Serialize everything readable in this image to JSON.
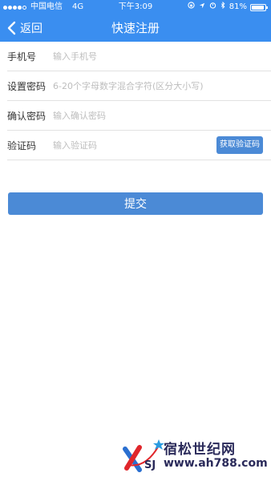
{
  "status_bar": {
    "carrier": "中国电信",
    "network": "4G",
    "time": "下午3:09",
    "battery": "81%",
    "battery_level": 0.81,
    "icons": [
      "lock-rotation-icon",
      "location-icon",
      "alarm-icon",
      "bluetooth-icon",
      "battery-icon"
    ]
  },
  "nav": {
    "back_label": "返回",
    "title": "快速注册",
    "back_icon": "chevron-left-icon"
  },
  "form": {
    "phone": {
      "label": "手机号",
      "placeholder": "输入手机号",
      "value": ""
    },
    "password": {
      "label": "设置密码",
      "placeholder": "6-20个字母数字混合字符(区分大小写)",
      "value": ""
    },
    "confirm": {
      "label": "确认密码",
      "placeholder": "输入确认密码",
      "value": ""
    },
    "code": {
      "label": "验证码",
      "placeholder": "输入验证码",
      "value": "",
      "button_label": "获取验证码"
    }
  },
  "submit_label": "提交",
  "watermark": {
    "name": "宿松世纪网",
    "url": "www.ah788.com",
    "logo_text": "SJ"
  },
  "colors": {
    "header": "#3a8ef0",
    "button": "#4b8ad6",
    "divider": "#e2e2e2",
    "placeholder": "#bdbdbd"
  }
}
